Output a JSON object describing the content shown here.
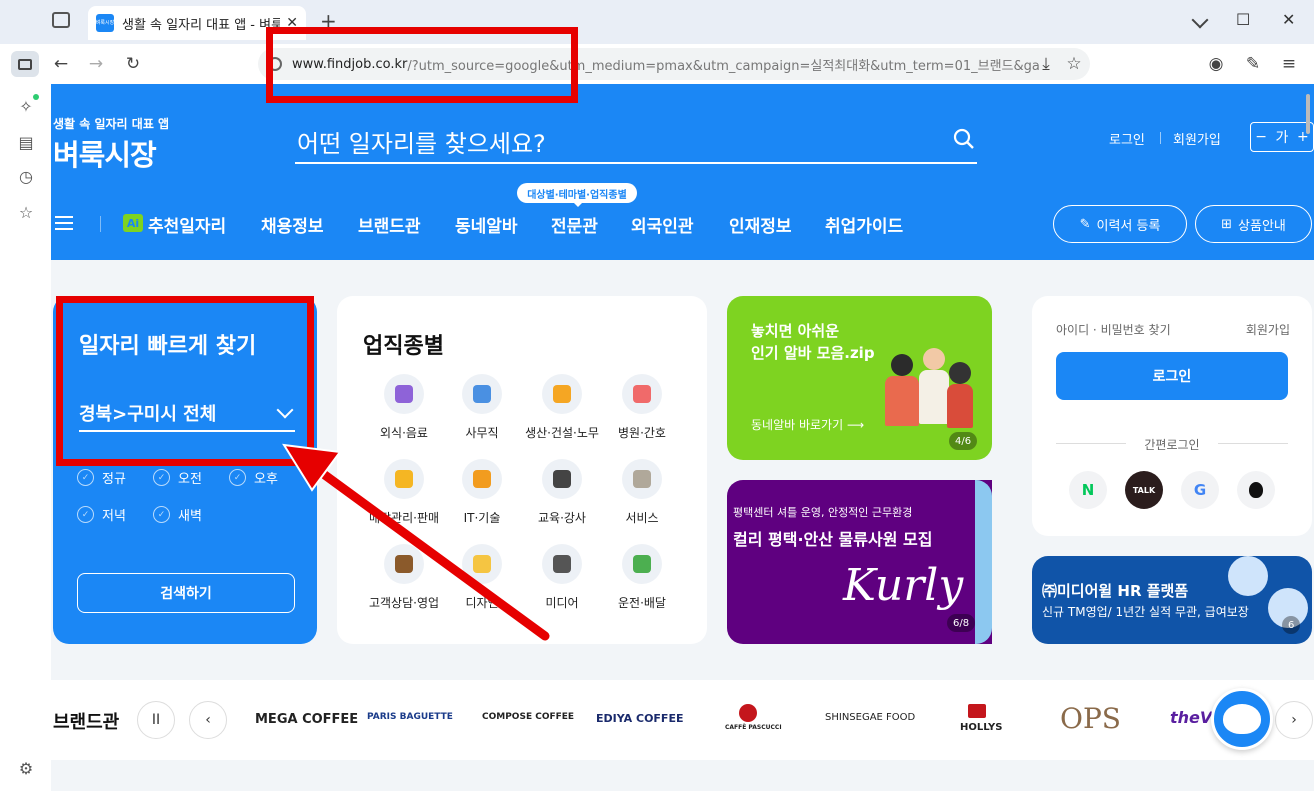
{
  "browser": {
    "tab_title": "생활 속 일자리 대표 앱 - 벼룩시장",
    "tab_favicon_text": "벼룩시장",
    "new_tab": "+",
    "close_tab": "✕",
    "url_host": "www.findjob.co.kr",
    "url_rest": "/?utm_source=google&utm_medium=pmax&utm_campaign=실적최대화&utm_term=01_브랜드&ga",
    "window_minimize": "—",
    "window_maximize": "☐",
    "window_close": "✕"
  },
  "header": {
    "tagline": "생활 속 일자리 대표 앱",
    "logo": "벼룩시장",
    "search_placeholder": "어떤 일자리를 찾으세요?",
    "login_link": "로그인",
    "signup_link": "회원가입",
    "font_minus": "−",
    "font_label": "가",
    "font_plus": "+"
  },
  "nav": {
    "ai_badge": "Ai",
    "items": [
      "추천일자리",
      "채용정보",
      "브랜드관",
      "동네알바",
      "전문관",
      "외국인관",
      "인재정보",
      "취업가이드"
    ],
    "bubble": "대상별·테마별·업직종별",
    "resume_button": "이력서 등록",
    "product_button": "상품안내"
  },
  "quick": {
    "title": "일자리 빠르게 찾기",
    "region": "경북>구미시 전체",
    "options": [
      "정규",
      "오전",
      "오후",
      "저녁",
      "새벽"
    ],
    "search_button": "검색하기"
  },
  "categories": {
    "title": "업직종별",
    "items": [
      {
        "label": "외식·음료",
        "color": "#8e63d8"
      },
      {
        "label": "사무직",
        "color": "#4a90e2"
      },
      {
        "label": "생산·건설·노무",
        "color": "#f5a623"
      },
      {
        "label": "병원·간호",
        "color": "#f06a6a"
      },
      {
        "label": "매장관리·판매",
        "color": "#f5b623"
      },
      {
        "label": "IT·기술",
        "color": "#f29c1f"
      },
      {
        "label": "교육·강사",
        "color": "#444444"
      },
      {
        "label": "서비스",
        "color": "#b0a89a"
      },
      {
        "label": "고객상담·영업",
        "color": "#8b5a2b"
      },
      {
        "label": "디자인",
        "color": "#f5c542"
      },
      {
        "label": "미디어",
        "color": "#555555"
      },
      {
        "label": "운전·배달",
        "color": "#4caf50"
      }
    ]
  },
  "banner_alba": {
    "line1": "놓치면 아쉬운",
    "line2": "인기 알바 모음.zip",
    "link": "동네알바 바로가기",
    "arrow": "⟶",
    "pager": "4/6"
  },
  "banner_kurly": {
    "subtitle": "평택센터 셔틀 운영, 안정적인 근무환경",
    "title": "컬리 평택·안산 물류사원 모집",
    "logo": "Kurly",
    "pager": "6/8"
  },
  "login_box": {
    "find": "아이디 · 비밀번호 찾기",
    "join": "회원가입",
    "login_button": "로그인",
    "simple_login": "간편로그인",
    "social": [
      {
        "label": "N",
        "color": "#03c75a"
      },
      {
        "label": "TALK",
        "color": "#3c1e1e"
      },
      {
        "label": "G",
        "color": "#4285f4"
      },
      {
        "label": "",
        "color": "#111111"
      }
    ]
  },
  "hr_banner": {
    "title": "㈜미디어윌  HR 플랫폼",
    "subtitle": "신규 TM영업/ 1년간 실적 무관, 급여보장",
    "pager": "6"
  },
  "brand_bar": {
    "title": "브랜드관",
    "pause": "II",
    "prev": "‹",
    "next": "›",
    "brands": [
      "MEGA COFFEE",
      "PARIS BAGUETTE",
      "COMPOSE COFFEE",
      "EDIYA COFFEE",
      "CAFFÈ PASCUCCI",
      "SHINSEGAE FOOD",
      "HOLLYS",
      "OPS",
      "theV"
    ]
  }
}
